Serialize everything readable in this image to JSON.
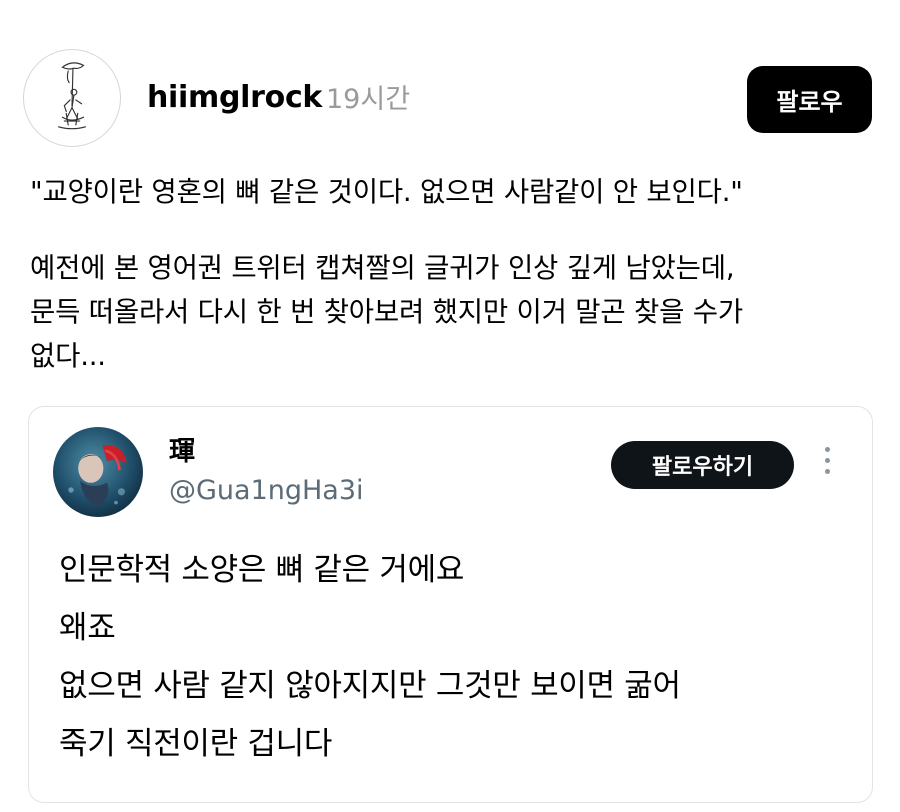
{
  "post": {
    "username": "hiimglrock",
    "timestamp": "19시간",
    "follow_label": "팔로우",
    "avatar_icon": "sketch-figure-avatar",
    "quote": "\"교양이란 영혼의 뼈 같은 것이다. 없으면 사람같이 안 보인다.\"",
    "body_lines": [
      "예전에 본 영어권 트위터 캡쳐짤의 글귀가 인상 깊게 남았는데,",
      "문득 떠올라서 다시 한 번 찾아보려 했지만 이거 말곤 찾을 수가",
      "없다..."
    ]
  },
  "embedded_tweet": {
    "name": "琿",
    "handle": "@Gua1ngHa3i",
    "follow_label": "팔로우하기",
    "avatar_icon": "underwater-figure-avatar",
    "more_icon": "more-vertical-icon",
    "lines": [
      "인문학적 소양은 뼈 같은 거에요",
      "왜죠",
      "없으면 사람 같지 않아지지만 그것만 보이면 굶어",
      "죽기 직전이란 겁니다"
    ]
  },
  "colors": {
    "timestamp": "#9a9a9a",
    "handle": "#5c6b75",
    "follow_button_bg": "#000000",
    "card_border": "#e3e3e3"
  }
}
